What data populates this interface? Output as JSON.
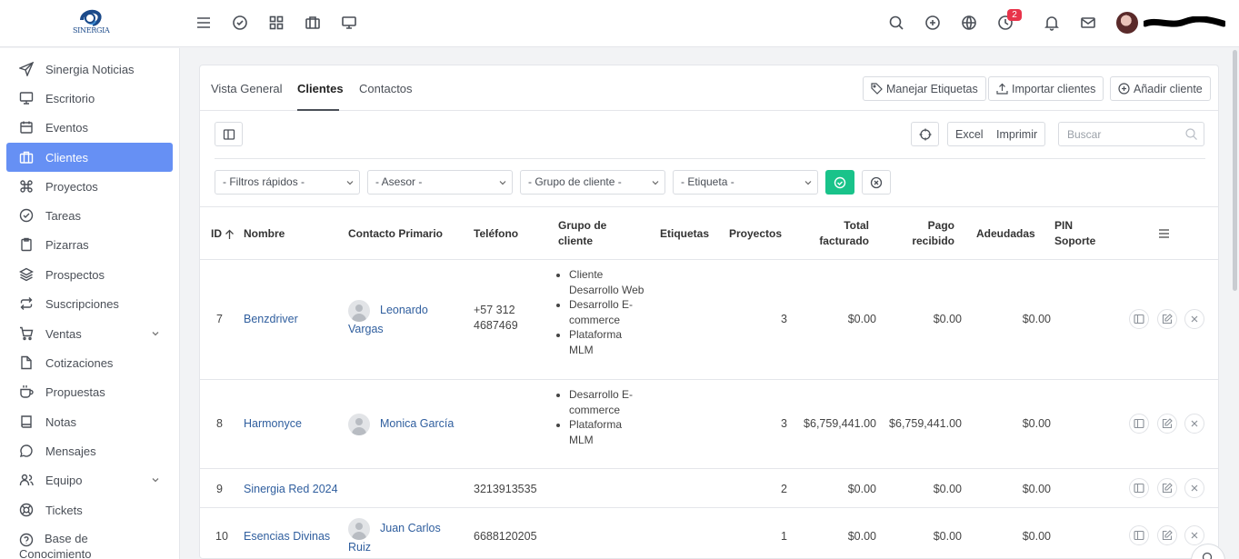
{
  "brand": {
    "logo_text": "SINERGIA"
  },
  "topbar": {
    "icons": [
      "menu-icon",
      "check-circle-icon",
      "grid-icon",
      "briefcase-icon",
      "monitor-icon",
      "search-icon",
      "plus-circle-icon",
      "globe-icon",
      "clock-icon",
      "bell-icon",
      "mail-icon"
    ],
    "notification_badge": "2"
  },
  "sidebar": {
    "items": [
      {
        "label": "Sinergia Noticias",
        "icon": "send-icon"
      },
      {
        "label": "Escritorio",
        "icon": "monitor-icon"
      },
      {
        "label": "Eventos",
        "icon": "calendar-icon"
      },
      {
        "label": "Clientes",
        "icon": "briefcase-icon",
        "active": true
      },
      {
        "label": "Proyectos",
        "icon": "command-icon"
      },
      {
        "label": "Tareas",
        "icon": "check-circle-icon"
      },
      {
        "label": "Pizarras",
        "icon": "clipboard-icon"
      },
      {
        "label": "Prospectos",
        "icon": "layers-icon"
      },
      {
        "label": "Suscripciones",
        "icon": "repeat-icon"
      },
      {
        "label": "Ventas",
        "icon": "cart-icon",
        "expandable": true
      },
      {
        "label": "Cotizaciones",
        "icon": "file-icon"
      },
      {
        "label": "Propuestas",
        "icon": "coffee-icon"
      },
      {
        "label": "Notas",
        "icon": "book-icon"
      },
      {
        "label": "Mensajes",
        "icon": "message-icon"
      },
      {
        "label": "Equipo",
        "icon": "users-icon",
        "expandable": true
      },
      {
        "label": "Tickets",
        "icon": "life-buoy-icon"
      }
    ],
    "last_item": {
      "line1": "Base de",
      "line2": "Conocimiento"
    }
  },
  "tabs": [
    {
      "label": "Vista General"
    },
    {
      "label": "Clientes",
      "active": true
    },
    {
      "label": "Contactos"
    }
  ],
  "actions": {
    "manage_tags": "Manejar Etiquetas",
    "import": "Importar clientes",
    "add": "Añadir cliente"
  },
  "toolbar": {
    "excel": "Excel",
    "print": "Imprimir",
    "search_placeholder": "Buscar"
  },
  "filters": {
    "quick": "- Filtros rápidos -",
    "advisor": "- Asesor -",
    "group": "- Grupo de cliente -",
    "tag": "- Etiqueta -"
  },
  "table": {
    "headers": {
      "id": "ID",
      "name": "Nombre",
      "contact": "Contacto Primario",
      "phone": "Teléfono",
      "group_1": "Grupo de",
      "group_2": "cliente",
      "tags": "Etiquetas",
      "projects": "Proyectos",
      "billed_1": "Total",
      "billed_2": "facturado",
      "paid_1": "Pago",
      "paid_2": "recibido",
      "due": "Adeudadas",
      "pin_1": "PIN",
      "pin_2": "Soporte"
    },
    "rows": [
      {
        "id": "7",
        "name": "Benzdriver",
        "contact_1": "Leonardo",
        "contact_2": "Vargas",
        "phone_1": "+57 312",
        "phone_2": "4687469",
        "groups": [
          "Cliente",
          "Desarrollo Web",
          "Desarrollo E-",
          "commerce",
          "Plataforma",
          "MLM"
        ],
        "projects": "3",
        "billed": "$0.00",
        "paid": "$0.00",
        "due": "$0.00"
      },
      {
        "id": "8",
        "name": "Harmonyce",
        "contact_1": "Monica García",
        "contact_2": "",
        "phone_1": "",
        "phone_2": "",
        "groups": [
          "Desarrollo E-",
          "commerce",
          "Plataforma",
          "MLM"
        ],
        "projects": "3",
        "billed": "$6,759,441.00",
        "paid": "$6,759,441.00",
        "due": "$0.00"
      },
      {
        "id": "9",
        "name": "Sinergia Red 2024",
        "contact_1": "",
        "contact_2": "",
        "phone_1": "3213913535",
        "phone_2": "",
        "groups": [],
        "projects": "2",
        "billed": "$0.00",
        "paid": "$0.00",
        "due": "$0.00"
      },
      {
        "id": "10",
        "name": "Esencias Divinas",
        "contact_1": "Juan Carlos",
        "contact_2": "Ruiz",
        "phone_1": "6688120205",
        "phone_2": "",
        "groups": [],
        "projects": "1",
        "billed": "$0.00",
        "paid": "$0.00",
        "due": "$0.00"
      }
    ]
  },
  "colors": {
    "accent": "#6690f4",
    "success": "#19c38a",
    "badge": "#e8334a",
    "link": "#2f5e9e"
  }
}
